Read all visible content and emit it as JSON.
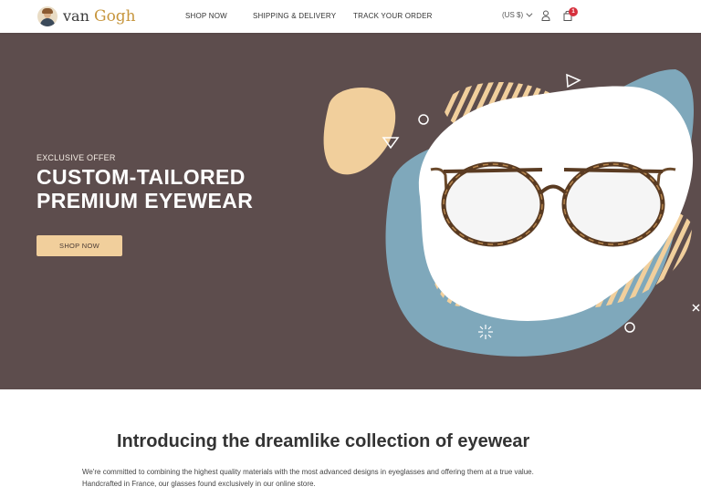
{
  "brand": {
    "name_prefix": "van",
    "name_main": "Gogh",
    "logo_icon": "van-gogh-portrait"
  },
  "nav": {
    "items": [
      {
        "label": "SHOP NOW"
      },
      {
        "label": "SHIPPING & DELIVERY"
      },
      {
        "label": "TRACK YOUR ORDER"
      }
    ]
  },
  "header_actions": {
    "currency": "(US $)",
    "user_icon": "user-icon",
    "cart_icon": "shopping-bag-icon",
    "cart_count": "1"
  },
  "hero": {
    "eyebrow": "EXCLUSIVE OFFER",
    "title_line1": "CUSTOM-TAILORED",
    "title_line2": "PREMIUM EYEWEAR",
    "button_label": "SHOP NOW",
    "colors": {
      "background": "#5d4d4d",
      "accent": "#f1cf9c",
      "blob_blue": "#7fa8bb",
      "badge": "#d6303d"
    }
  },
  "intro": {
    "title": "Introducing the dreamlike collection of eyewear",
    "text": "We're committed to combining the highest quality materials with the most advanced designs in eyeglasses and offering them at a true value. Handcrafted in France, our glasses found exclusively in our online store."
  }
}
